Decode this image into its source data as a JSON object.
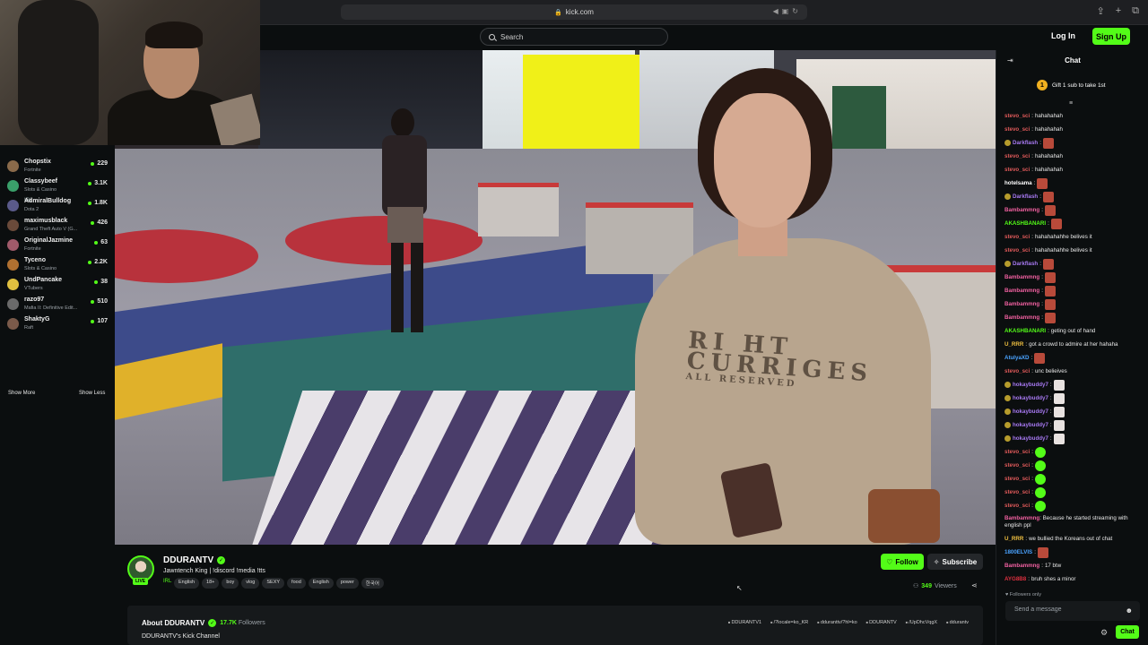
{
  "browser": {
    "url": "kick.com"
  },
  "header": {
    "search_placeholder": "Search",
    "login_label": "Log In",
    "signup_label": "Sign Up"
  },
  "sidebar": {
    "irl_label": "IRL",
    "channels": [
      {
        "name": "Chopstix",
        "game": "Fortnite",
        "viewers": "229"
      },
      {
        "name": "Classybeef",
        "game": "Slots & Casino",
        "viewers": "3.1K"
      },
      {
        "name": "AdmiralBulldog",
        "game": "Dota 2",
        "viewers": "1.8K"
      },
      {
        "name": "maximusblack",
        "game": "Grand Theft Auto V (G...",
        "viewers": "426"
      },
      {
        "name": "OriginalJazmine",
        "game": "Fortnite",
        "viewers": "63"
      },
      {
        "name": "Tyceno",
        "game": "Slots & Casino",
        "viewers": "2.2K"
      },
      {
        "name": "UndPancake",
        "game": "VTubers",
        "viewers": "38"
      },
      {
        "name": "razo97",
        "game": "Mafia II: Definitive Edit...",
        "viewers": "510"
      },
      {
        "name": "ShaktyG",
        "game": "Raft",
        "viewers": "107"
      }
    ],
    "show_more": "Show More",
    "show_less": "Show Less"
  },
  "stream": {
    "shirt_print_line1": "RI HT",
    "shirt_print_line2": "CURRIGES",
    "shirt_print_line3": "ALL RESERVED"
  },
  "channel": {
    "name": "DDURANTV",
    "live_badge": "LIVE",
    "title": "Jawntench King | !discord !media !tts",
    "category": "IRL",
    "tags": [
      "English",
      "18+",
      "boy",
      "vlog",
      "SEXY",
      "food",
      "English",
      "power",
      "한국어"
    ],
    "follow_label": "Follow",
    "subscribe_label": "Subscribe",
    "viewer_count": "349",
    "viewers_label": "Viewers",
    "about_title": "About DDURANTV",
    "followers_count": "17.7K",
    "followers_label": "Followers",
    "description": "DDURANTV's Kick Channel",
    "socials": [
      "DDURANTV1",
      "/?locale=ko_KR",
      "dduranttv/?hl=ko",
      "DDURANTV",
      "/UpDhcVqgX",
      "ddurantv"
    ]
  },
  "chat": {
    "title": "Chat",
    "gift_text": "Gift 1 sub to take 1st",
    "gift_number": "1",
    "messages": [
      {
        "user": "stevo_sci",
        "text": "hahahahah",
        "color": "#e05a5a"
      },
      {
        "user": "stevo_sci",
        "text": "hahahahah",
        "color": "#e05a5a"
      },
      {
        "user": "Darkflash",
        "text": "",
        "color": "#a678f0",
        "emote": "red",
        "badge": true
      },
      {
        "user": "stevo_sci",
        "text": "hahahahah",
        "color": "#e05a5a"
      },
      {
        "user": "stevo_sci",
        "text": "hahahahah",
        "color": "#e05a5a"
      },
      {
        "user": "hotelsama",
        "text": "",
        "color": "#ffffff",
        "emote": "red"
      },
      {
        "user": "Darkflash",
        "text": "",
        "color": "#a678f0",
        "emote": "red",
        "badge": true
      },
      {
        "user": "Bambammng",
        "text": "",
        "color": "#f060a0",
        "emote": "red"
      },
      {
        "user": "AKASHBANARI",
        "text": "",
        "color": "#53fc18",
        "emote": "red"
      },
      {
        "user": "stevo_sci",
        "text": "hahahahahhe belives it",
        "color": "#e05a5a"
      },
      {
        "user": "stevo_sci",
        "text": "hahahahahhe belives it",
        "color": "#e05a5a"
      },
      {
        "user": "Darkflash",
        "text": "",
        "color": "#a678f0",
        "emote": "red",
        "badge": true
      },
      {
        "user": "Bambammng",
        "text": "",
        "color": "#f060a0",
        "emote": "red"
      },
      {
        "user": "Bambammng",
        "text": "",
        "color": "#f060a0",
        "emote": "red"
      },
      {
        "user": "Bambammng",
        "text": "",
        "color": "#f060a0",
        "emote": "red"
      },
      {
        "user": "Bambammng",
        "text": "",
        "color": "#f060a0",
        "emote": "red"
      },
      {
        "user": "AKASHBANARI",
        "text": "geting out of hand",
        "color": "#53fc18"
      },
      {
        "user": "U_RRR",
        "text": "got a crowd to admire at her hahaha",
        "color": "#f0c040"
      },
      {
        "user": "AtulyaXD",
        "text": "",
        "color": "#4aa3ff",
        "emote": "red"
      },
      {
        "user": "stevo_sci",
        "text": "unc belieives",
        "color": "#e05a5a"
      },
      {
        "user": "hokaybuddy7",
        "text": "",
        "color": "#a678f0",
        "emote": "white",
        "badge": true
      },
      {
        "user": "hokaybuddy7",
        "text": "",
        "color": "#a678f0",
        "emote": "white",
        "badge": true
      },
      {
        "user": "hokaybuddy7",
        "text": "",
        "color": "#a678f0",
        "emote": "white",
        "badge": true
      },
      {
        "user": "hokaybuddy7",
        "text": "",
        "color": "#a678f0",
        "emote": "white",
        "badge": true
      },
      {
        "user": "hokaybuddy7",
        "text": "",
        "color": "#a678f0",
        "emote": "white",
        "badge": true
      },
      {
        "user": "stevo_sci",
        "text": "",
        "color": "#e05a5a",
        "emote": "green"
      },
      {
        "user": "stevo_sci",
        "text": "",
        "color": "#e05a5a",
        "emote": "green"
      },
      {
        "user": "stevo_sci",
        "text": "",
        "color": "#e05a5a",
        "emote": "green"
      },
      {
        "user": "stevo_sci",
        "text": "",
        "color": "#e05a5a",
        "emote": "green"
      },
      {
        "user": "stevo_sci",
        "text": "",
        "color": "#e05a5a",
        "emote": "green"
      },
      {
        "user": "Bambammng",
        "text": "Because he started streaming with english ppl",
        "color": "#f060a0",
        "two": true
      },
      {
        "user": "U_RRR",
        "text": "we bullied the Koreans out of chat",
        "color": "#f0c040"
      },
      {
        "user": "1800ELVIS",
        "text": "",
        "color": "#4aa3ff",
        "emote": "red"
      },
      {
        "user": "Bambammng",
        "text": "17 btw",
        "color": "#f060a0"
      },
      {
        "user": "AYG8B8",
        "text": "bruh shes a minor",
        "color": "#e03040"
      }
    ],
    "followers_only": "Followers only",
    "send_placeholder": "Send a message",
    "chat_button": "Chat"
  },
  "colors": {
    "accent": "#53fc18",
    "background": "#0b0e0f"
  }
}
